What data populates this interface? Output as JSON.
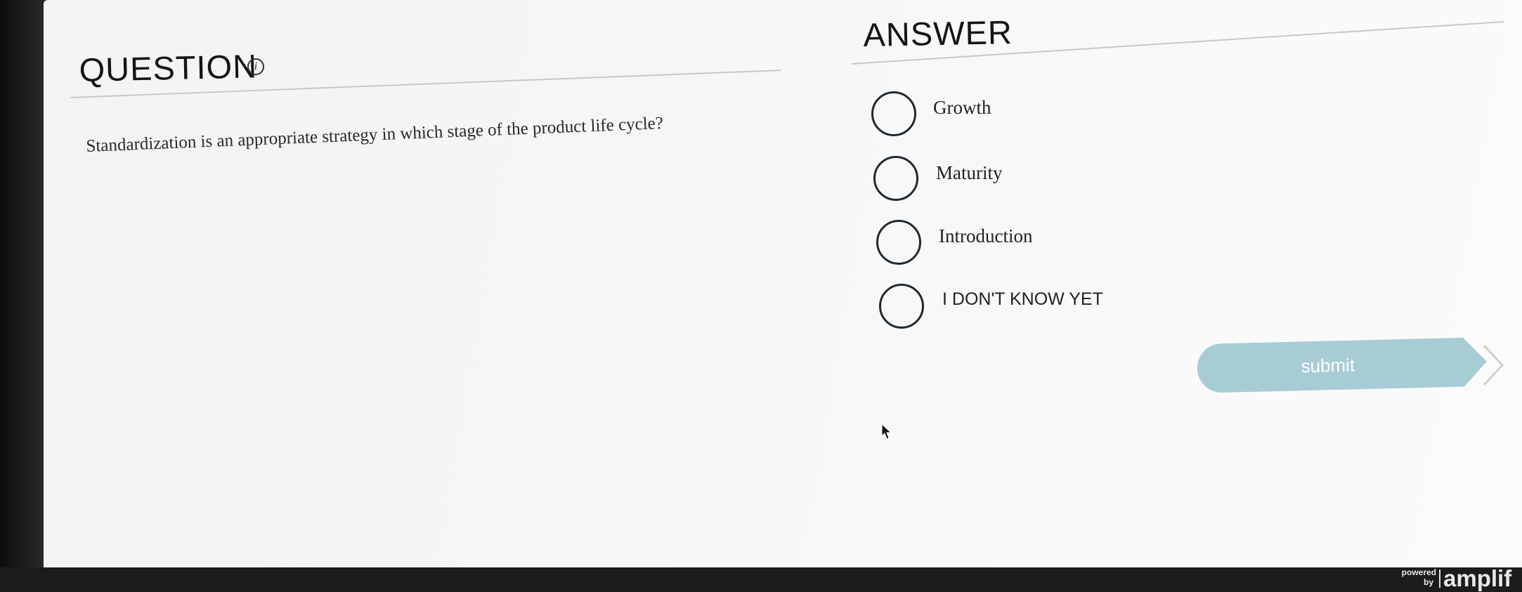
{
  "question": {
    "title": "QUESTION",
    "info_glyph": "i",
    "text": "Standardization is an appropriate strategy in which stage of the product life cycle?"
  },
  "answer": {
    "title": "ANSWER",
    "options": [
      {
        "label": "Growth"
      },
      {
        "label": "Maturity"
      },
      {
        "label": "Introduction"
      },
      {
        "label": "I DON'T KNOW YET"
      }
    ]
  },
  "submit": {
    "label": "submit"
  },
  "footer": {
    "powered": "powered",
    "by": "by",
    "brand": "amplif"
  },
  "colors": {
    "submit_bg": "#a8ccd6",
    "radio_border": "#1f2a33",
    "background": "#f5f5f5"
  },
  "icons": {
    "info": "info-icon",
    "cursor": "mouse-cursor-icon",
    "chevron": "chevron-right-icon"
  }
}
